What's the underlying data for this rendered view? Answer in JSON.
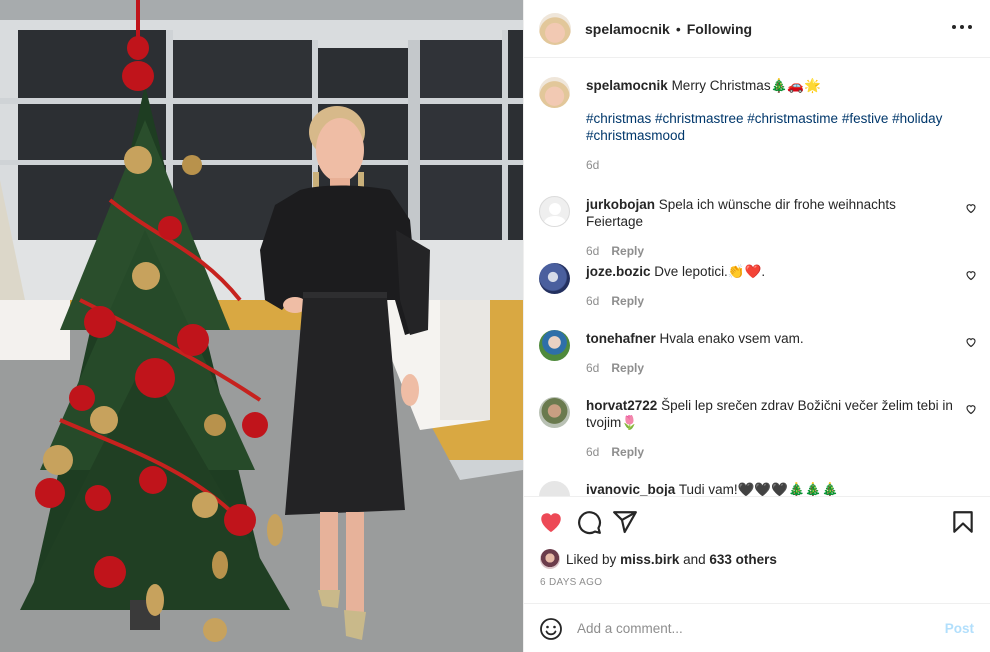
{
  "post": {
    "username": "spelamocnik",
    "follow_status": "Following",
    "separator": "•",
    "caption": "Merry Christmas🎄🚗🌟",
    "hashtags": "#christmas #christmastree #christmastime #festive #holiday #christmasmood",
    "caption_time": "6d"
  },
  "comments": [
    {
      "user": "jurkobojan",
      "text": "Spela ich wünsche dir frohe weihnachts Feiertage",
      "time": "6d",
      "reply": "Reply",
      "avatar": "default-avatar"
    },
    {
      "user": "joze.bozic",
      "text": "Dve lepotici.👏❤️.",
      "time": "6d",
      "reply": "Reply",
      "avatar": "profile-photo"
    },
    {
      "user": "tonehafner",
      "text": "Hvala enako vsem vam.",
      "time": "6d",
      "reply": "Reply",
      "avatar": "profile-photo"
    },
    {
      "user": "horvat2722",
      "text": "Špeli lep srečen zdrav Božični večer želim tebi in tvojim🌷",
      "time": "6d",
      "reply": "Reply",
      "avatar": "profile-photo"
    },
    {
      "user": "ivanovic_boja",
      "text": "Tudi vam!🖤🖤🖤🎄🎄🎄",
      "time": "",
      "reply": "",
      "avatar": "profile-photo"
    }
  ],
  "actions": {
    "liked_by_prefix": "Liked by",
    "liked_by_user": "miss.birk",
    "liked_by_suffix": "and",
    "others": "633 others",
    "posted_ago": "6 DAYS AGO",
    "comment_placeholder": "Add a comment...",
    "post_label": "Post"
  },
  "icons": {
    "like": "heart-filled-icon",
    "comment": "comment-icon",
    "share": "share-icon",
    "save": "bookmark-icon",
    "more": "more-options-icon",
    "emoji": "emoji-icon"
  },
  "colors": {
    "like_red": "#ed4956",
    "hashtag_blue": "#00376b",
    "muted": "#8e8e8e",
    "post_disabled": "#b2dffc"
  }
}
